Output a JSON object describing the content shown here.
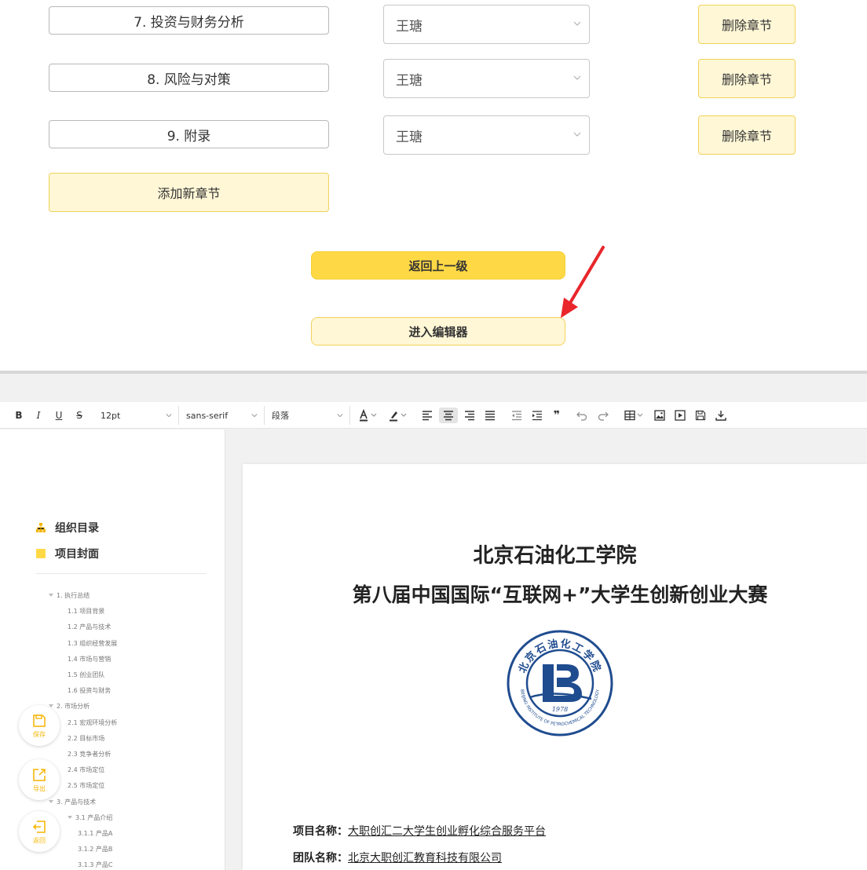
{
  "chapters": [
    {
      "title": "7. 投资与财务分析",
      "author": "王瑭",
      "delete_label": "删除章节"
    },
    {
      "title": "8. 风险与对策",
      "author": "王瑭",
      "delete_label": "删除章节"
    },
    {
      "title": "9. 附录",
      "author": "王瑭",
      "delete_label": "删除章节"
    }
  ],
  "add_chapter_label": "添加新章节",
  "back_label": "返回上一级",
  "editor_label": "进入编辑器",
  "colors": {
    "accent_yellow": "#ffd945",
    "light_yellow": "#fff7d6",
    "annotation_red": "#e8262b",
    "logo_blue": "#1f4c8f"
  },
  "toolbar": {
    "bold": "B",
    "italic": "I",
    "underline": "U",
    "strike": "S",
    "font_size": "12pt",
    "font_family": "sans-serif",
    "paragraph": "段落",
    "quote": "❞"
  },
  "sidebar": {
    "org_label": "组织目录",
    "cover_label": "项目封面",
    "toc": [
      {
        "label": "1. 执行总结",
        "level": 0,
        "expanded": true
      },
      {
        "label": "1.1 项目背景",
        "level": 1
      },
      {
        "label": "1.2 产品与技术",
        "level": 1
      },
      {
        "label": "1.3 组织经营发展",
        "level": 1
      },
      {
        "label": "1.4 市场与营销",
        "level": 1
      },
      {
        "label": "1.5 创业团队",
        "level": 1
      },
      {
        "label": "1.6 投资与财务",
        "level": 1
      },
      {
        "label": "2. 市场分析",
        "level": 0,
        "expanded": true
      },
      {
        "label": "2.1 宏观环境分析",
        "level": 1
      },
      {
        "label": "2.2 目标市场",
        "level": 1
      },
      {
        "label": "2.3 竞争者分析",
        "level": 1
      },
      {
        "label": "2.4 市场定位",
        "level": 1
      },
      {
        "label": "2.5 市场定位",
        "level": 1
      },
      {
        "label": "3. 产品与技术",
        "level": 0,
        "expanded": true
      },
      {
        "label": "3.1 产品介绍",
        "level": 1,
        "expanded": true
      },
      {
        "label": "3.1.1 产品A",
        "level": 2
      },
      {
        "label": "3.1.2 产品B",
        "level": 2
      },
      {
        "label": "3.1.3 产品C",
        "level": 2
      }
    ],
    "float_buttons": {
      "save": "保存",
      "export": "导出",
      "back": "返回"
    }
  },
  "document": {
    "title1": "北京石油化工学院",
    "title2": "第八届中国国际“互联网+”大学生创新创业大赛",
    "logo_text": "北京石油化工学院",
    "logo_year": "1978",
    "logo_en": "BEIJING INSTITUTE OF PETROCHEMICAL TECHNOLOGY",
    "project_label": "项目名称：",
    "project_value": "大职创汇二大学生创业孵化综合服务平台",
    "team_label": "团队名称：",
    "team_value": "北京大职创汇教育科技有限公司"
  }
}
